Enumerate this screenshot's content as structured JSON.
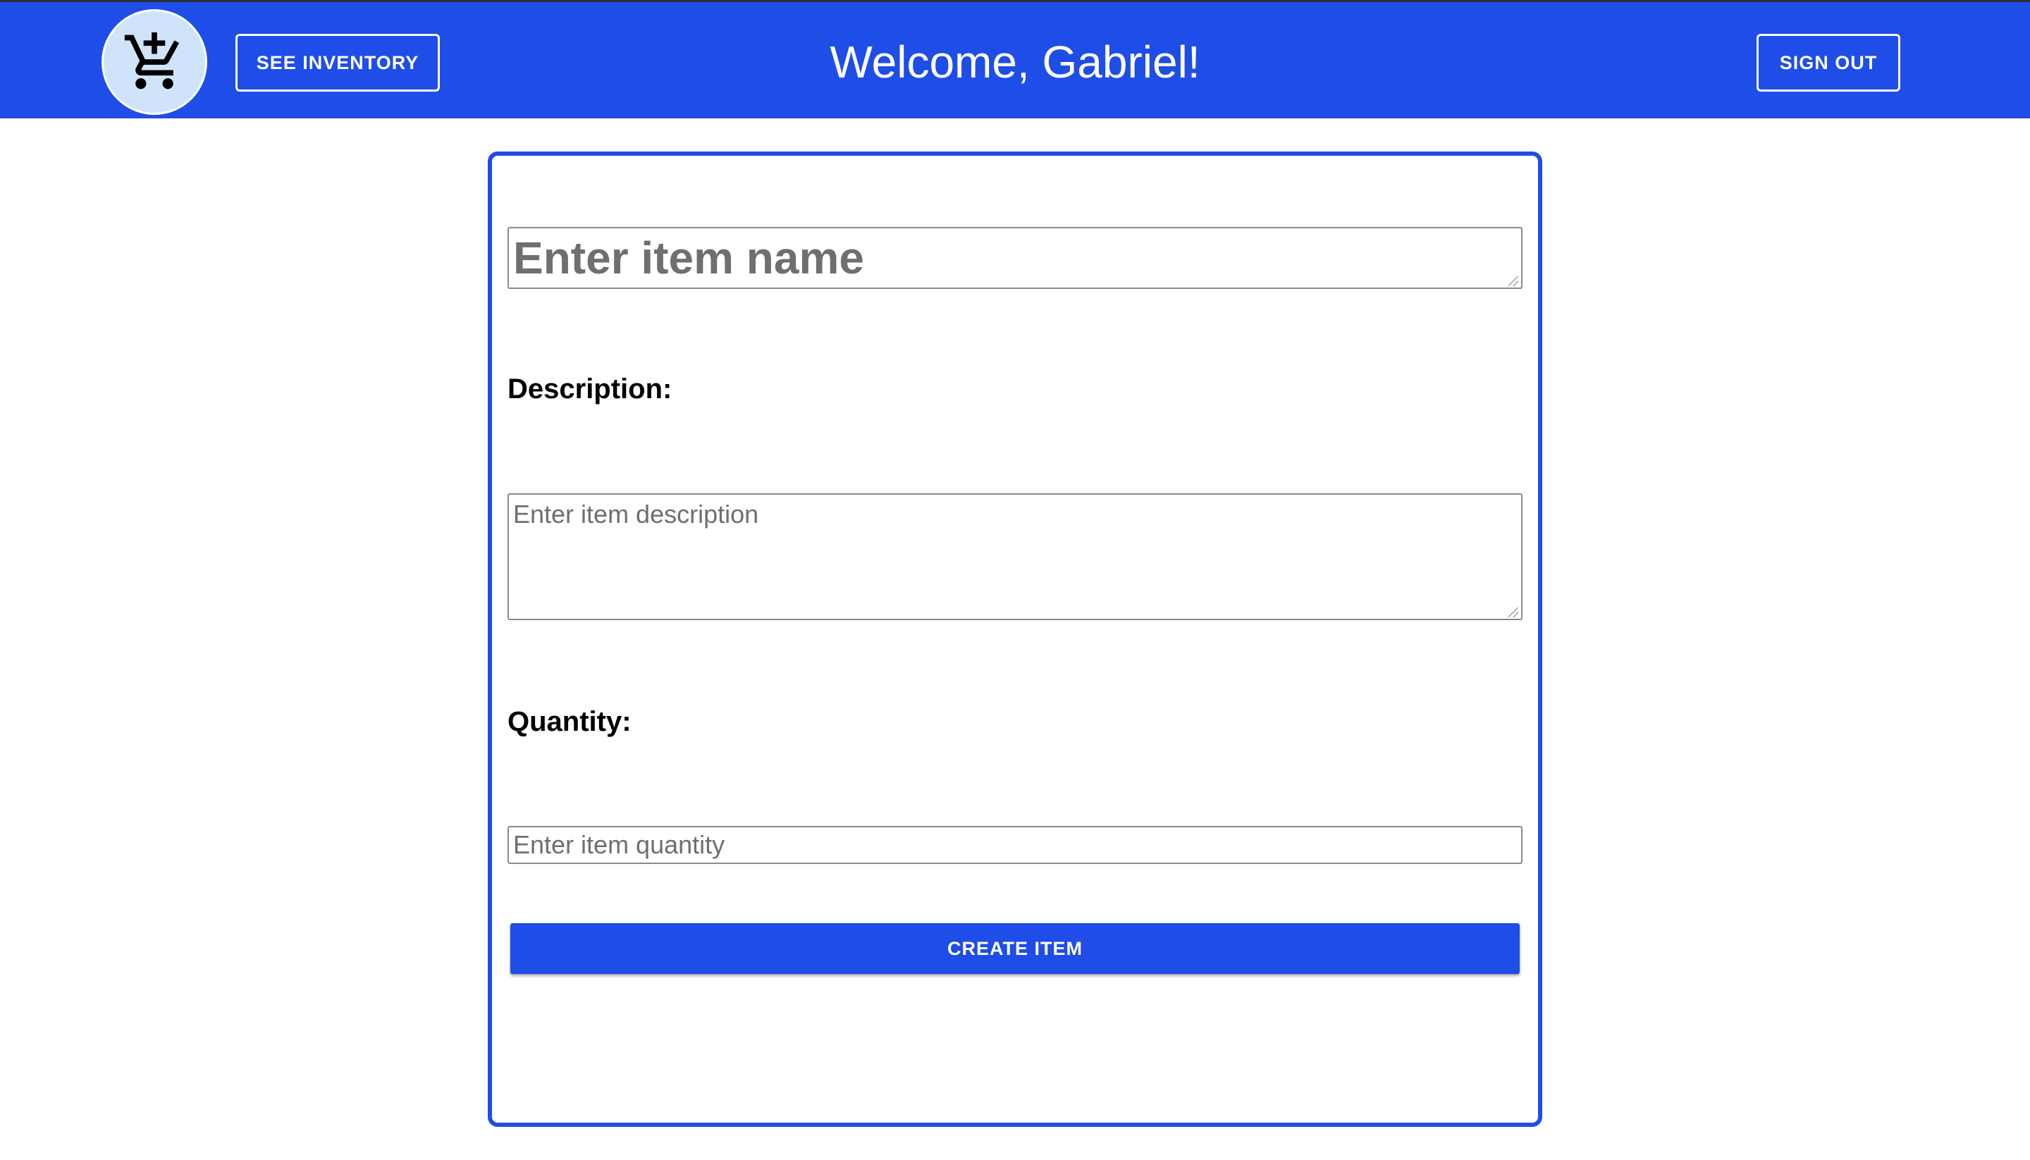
{
  "header": {
    "logo_icon": "shopping-cart-alert-icon",
    "see_inventory_label": "SEE INVENTORY",
    "welcome_text": "Welcome, Gabriel!",
    "sign_out_label": "SIGN OUT"
  },
  "form": {
    "name_placeholder": "Enter item name",
    "description_label": "Description:",
    "description_placeholder": "Enter item description",
    "quantity_label": "Quantity:",
    "quantity_placeholder": "Enter item quantity",
    "create_label": "CREATE ITEM"
  },
  "colors": {
    "brand_blue": "#1f4de8",
    "logo_bg": "#cfe4fb",
    "placeholder_gray": "#6f6f6f"
  }
}
